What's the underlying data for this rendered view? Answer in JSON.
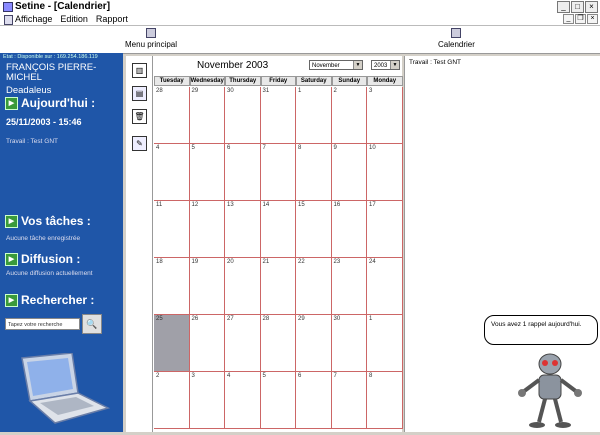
{
  "window": {
    "title": "Setine - [Calendrier]"
  },
  "menu": [
    "Affichage",
    "Edition",
    "Rapport"
  ],
  "toolbar": {
    "menu_principal": "Menu principal",
    "calendrier": "Calendrier"
  },
  "sidebar": {
    "status": "Etat : Disponible       sur : 169.254.186.119",
    "name_line1": "FRANÇOIS PIERRE-MICHEL",
    "name_line2": "Deadaleus",
    "today_heading": "Aujourd'hui :",
    "today_datetime": "25/11/2003 - 15:46",
    "today_event": "Travail : Test GNT",
    "tasks_heading": "Vos tâches :",
    "tasks_text": "Aucune tâche enregistrée",
    "diffusion_heading": "Diffusion :",
    "diffusion_text": "Aucune diffusion actuellement",
    "search_heading": "Rechercher :",
    "search_placeholder": "Tapez votre recherche"
  },
  "calendar": {
    "title": "November 2003",
    "month_select": "November",
    "year_select": "2003",
    "days": [
      "Tuesday",
      "Wednesday",
      "Thursday",
      "Friday",
      "Saturday",
      "Sunday",
      "Monday"
    ],
    "weeks": [
      [
        "28",
        "29",
        "30",
        "31",
        "1",
        "2",
        "3"
      ],
      [
        "4",
        "5",
        "6",
        "7",
        "8",
        "9",
        "10"
      ],
      [
        "11",
        "12",
        "13",
        "14",
        "15",
        "16",
        "17"
      ],
      [
        "18",
        "19",
        "20",
        "21",
        "22",
        "23",
        "24"
      ],
      [
        "25",
        "26",
        "27",
        "28",
        "29",
        "30",
        "1"
      ],
      [
        "2",
        "3",
        "4",
        "5",
        "6",
        "7",
        "8"
      ]
    ]
  },
  "detail": {
    "event": "Travail : Test GNT"
  },
  "assistant": {
    "message": "Vous avez 1 rappel aujourd'hui."
  }
}
